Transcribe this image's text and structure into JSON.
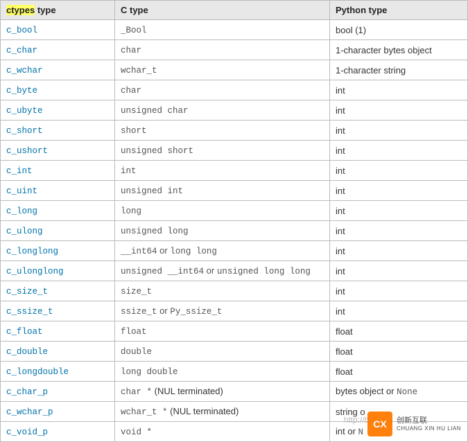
{
  "table": {
    "headers": {
      "col1_hl": "ctypes",
      "col1_rest": " type",
      "col2": "C type",
      "col3": "Python type"
    },
    "rows": [
      {
        "ctypes": "c_bool",
        "ctype_segments": [
          {
            "t": "mono",
            "v": "_Bool"
          }
        ],
        "py_segments": [
          {
            "t": "plain",
            "v": "bool (1)"
          }
        ]
      },
      {
        "ctypes": "c_char",
        "ctype_segments": [
          {
            "t": "mono",
            "v": "char"
          }
        ],
        "py_segments": [
          {
            "t": "plain",
            "v": "1-character bytes object"
          }
        ]
      },
      {
        "ctypes": "c_wchar",
        "ctype_segments": [
          {
            "t": "mono",
            "v": "wchar_t"
          }
        ],
        "py_segments": [
          {
            "t": "plain",
            "v": "1-character string"
          }
        ]
      },
      {
        "ctypes": "c_byte",
        "ctype_segments": [
          {
            "t": "mono",
            "v": "char"
          }
        ],
        "py_segments": [
          {
            "t": "plain",
            "v": "int"
          }
        ]
      },
      {
        "ctypes": "c_ubyte",
        "ctype_segments": [
          {
            "t": "mono",
            "v": "unsigned char"
          }
        ],
        "py_segments": [
          {
            "t": "plain",
            "v": "int"
          }
        ]
      },
      {
        "ctypes": "c_short",
        "ctype_segments": [
          {
            "t": "mono",
            "v": "short"
          }
        ],
        "py_segments": [
          {
            "t": "plain",
            "v": "int"
          }
        ]
      },
      {
        "ctypes": "c_ushort",
        "ctype_segments": [
          {
            "t": "mono",
            "v": "unsigned short"
          }
        ],
        "py_segments": [
          {
            "t": "plain",
            "v": "int"
          }
        ]
      },
      {
        "ctypes": "c_int",
        "ctype_segments": [
          {
            "t": "mono",
            "v": "int"
          }
        ],
        "py_segments": [
          {
            "t": "plain",
            "v": "int"
          }
        ]
      },
      {
        "ctypes": "c_uint",
        "ctype_segments": [
          {
            "t": "mono",
            "v": "unsigned int"
          }
        ],
        "py_segments": [
          {
            "t": "plain",
            "v": "int"
          }
        ]
      },
      {
        "ctypes": "c_long",
        "ctype_segments": [
          {
            "t": "mono",
            "v": "long"
          }
        ],
        "py_segments": [
          {
            "t": "plain",
            "v": "int"
          }
        ]
      },
      {
        "ctypes": "c_ulong",
        "ctype_segments": [
          {
            "t": "mono",
            "v": "unsigned long"
          }
        ],
        "py_segments": [
          {
            "t": "plain",
            "v": "int"
          }
        ]
      },
      {
        "ctypes": "c_longlong",
        "ctype_segments": [
          {
            "t": "mono",
            "v": "__int64"
          },
          {
            "t": "or",
            "v": " or "
          },
          {
            "t": "mono",
            "v": "long long"
          }
        ],
        "py_segments": [
          {
            "t": "plain",
            "v": "int"
          }
        ]
      },
      {
        "ctypes": "c_ulonglong",
        "ctype_segments": [
          {
            "t": "mono",
            "v": "unsigned __int64"
          },
          {
            "t": "or",
            "v": " or "
          },
          {
            "t": "mono",
            "v": "unsigned long long"
          }
        ],
        "py_segments": [
          {
            "t": "plain",
            "v": "int"
          }
        ]
      },
      {
        "ctypes": "c_size_t",
        "ctype_segments": [
          {
            "t": "mono",
            "v": "size_t"
          }
        ],
        "py_segments": [
          {
            "t": "plain",
            "v": "int"
          }
        ]
      },
      {
        "ctypes": "c_ssize_t",
        "ctype_segments": [
          {
            "t": "mono",
            "v": "ssize_t"
          },
          {
            "t": "or",
            "v": " or "
          },
          {
            "t": "mono",
            "v": "Py_ssize_t"
          }
        ],
        "py_segments": [
          {
            "t": "plain",
            "v": "int"
          }
        ]
      },
      {
        "ctypes": "c_float",
        "ctype_segments": [
          {
            "t": "mono",
            "v": "float"
          }
        ],
        "py_segments": [
          {
            "t": "plain",
            "v": "float"
          }
        ]
      },
      {
        "ctypes": "c_double",
        "ctype_segments": [
          {
            "t": "mono",
            "v": "double"
          }
        ],
        "py_segments": [
          {
            "t": "plain",
            "v": "float"
          }
        ]
      },
      {
        "ctypes": "c_longdouble",
        "ctype_segments": [
          {
            "t": "mono",
            "v": "long double"
          }
        ],
        "py_segments": [
          {
            "t": "plain",
            "v": "float"
          }
        ]
      },
      {
        "ctypes": "c_char_p",
        "ctype_segments": [
          {
            "t": "mono",
            "v": "char *"
          },
          {
            "t": "plain",
            "v": " (NUL terminated)"
          }
        ],
        "py_segments": [
          {
            "t": "plain",
            "v": "bytes object or "
          },
          {
            "t": "mono",
            "v": "None"
          }
        ]
      },
      {
        "ctypes": "c_wchar_p",
        "ctype_segments": [
          {
            "t": "mono",
            "v": "wchar_t *"
          },
          {
            "t": "plain",
            "v": " (NUL terminated)"
          }
        ],
        "py_segments": [
          {
            "t": "plain",
            "v": "string o"
          }
        ]
      },
      {
        "ctypes": "c_void_p",
        "ctype_segments": [
          {
            "t": "mono",
            "v": "void *"
          }
        ],
        "py_segments": [
          {
            "t": "plain",
            "v": "int or "
          },
          {
            "t": "mono",
            "v": "N"
          }
        ]
      }
    ]
  },
  "watermark": {
    "url": "http://bl",
    "badge": "CX",
    "line1": "创新互联",
    "line2": "CHUANG XIN HU LIAN"
  }
}
